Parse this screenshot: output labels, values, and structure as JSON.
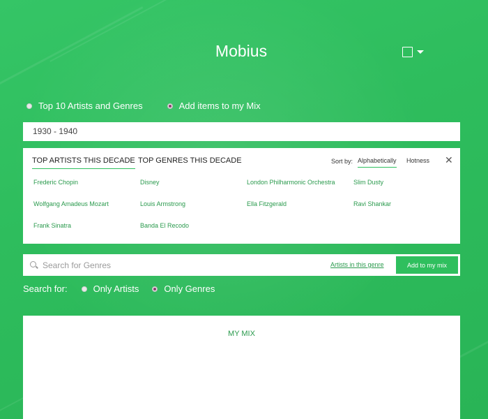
{
  "app": {
    "title": "Mobius"
  },
  "header": {
    "menu_icon": "square-icon",
    "caret_icon": "caret-down-icon"
  },
  "modes": [
    {
      "label": "Top 10 Artists and Genres",
      "checked": false
    },
    {
      "label": "Add items to my Mix",
      "checked": true
    }
  ],
  "decade": {
    "value": "1930 - 1940"
  },
  "panel": {
    "tabs": [
      {
        "label": "TOP ARTISTS THIS DECADE",
        "active": true
      },
      {
        "label": "TOP GENRES THIS DECADE",
        "active": false
      }
    ],
    "sort_label": "Sort by:",
    "sort_options": [
      "Alphabetically",
      "Hotness"
    ],
    "sort_selected": "Alphabetically",
    "close_icon": "close-icon",
    "items": [
      "Frederic Chopin",
      "Disney",
      "London Philharmonic Orchestra",
      "Slim Dusty",
      "Wolfgang Amadeus Mozart",
      "Louis Armstrong",
      "Ella Fitzgerald",
      "Ravi Shankar",
      "Frank Sinatra",
      "Banda El Recodo"
    ]
  },
  "search": {
    "placeholder": "Search for Genres",
    "link": "Artists in this genre",
    "button": "Add to my mix"
  },
  "search_for": {
    "label": "Search for:",
    "options": [
      {
        "label": "Only Artists",
        "checked": false
      },
      {
        "label": "Only Genres",
        "checked": true
      }
    ]
  },
  "mix": {
    "title": "MY MIX"
  },
  "colors": {
    "background": "#2fbf5e",
    "accent": "#2a9a4d"
  }
}
